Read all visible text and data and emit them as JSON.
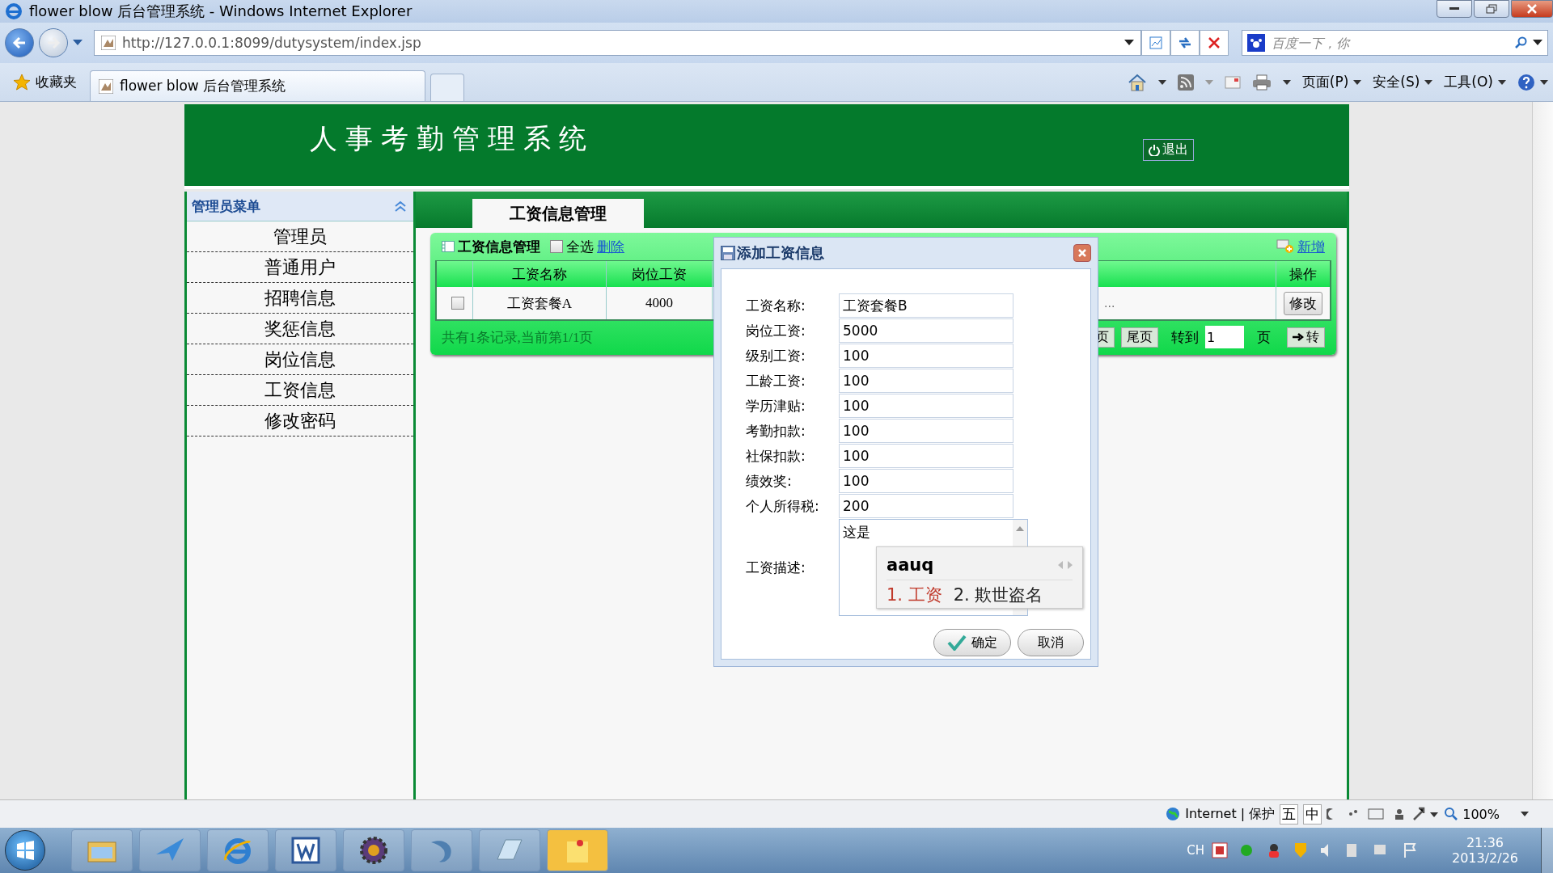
{
  "window": {
    "title": "flower blow 后台管理系统 - Windows Internet Explorer"
  },
  "address_bar": {
    "url": "http://127.0.0.1:8099/dutysystem/index.jsp"
  },
  "search": {
    "placeholder": "百度一下，你"
  },
  "favorites": {
    "label": "收藏夹"
  },
  "tabs": [
    {
      "label": "flower blow 后台管理系统",
      "selected": true
    }
  ],
  "command_bar": [
    {
      "label": "页面(P)"
    },
    {
      "label": "安全(S)"
    },
    {
      "label": "工具(O)"
    }
  ],
  "page": {
    "header_title": "人事考勤管理系统",
    "logout": "退出",
    "sidebar": {
      "title": "管理员菜单",
      "items": [
        {
          "label": "管理员"
        },
        {
          "label": "普通用户"
        },
        {
          "label": "招聘信息"
        },
        {
          "label": "奖惩信息"
        },
        {
          "label": "岗位信息"
        },
        {
          "label": "工资信息"
        },
        {
          "label": "修改密码"
        }
      ]
    },
    "main_tab": "工资信息管理",
    "grid": {
      "title": "工资信息管理",
      "select_all": {
        "label": "全选",
        "checked": false
      },
      "delete_link": "删除",
      "add_link": "新增",
      "columns": [
        "工资名称",
        "岗位工资",
        "操作"
      ],
      "rows": [
        {
          "checked": false,
          "name": "工资套餐A",
          "salary": "4000",
          "more": "...",
          "action": "修改"
        }
      ],
      "pager": {
        "summary": "共有1条记录,当前第1/1页",
        "buttons": [
          "页",
          "尾页"
        ],
        "goto_label": "转到",
        "page_value": "1",
        "page_unit": "页",
        "go_button": "转"
      }
    }
  },
  "dialog": {
    "title": "添加工资信息",
    "fields": [
      {
        "label": "工资名称:",
        "value": "工资套餐B"
      },
      {
        "label": "岗位工资:",
        "value": "5000"
      },
      {
        "label": "级别工资:",
        "value": "100"
      },
      {
        "label": "工龄工资:",
        "value": "100"
      },
      {
        "label": "学历津贴:",
        "value": "100"
      },
      {
        "label": "考勤扣款:",
        "value": "100"
      },
      {
        "label": "社保扣款:",
        "value": "100"
      },
      {
        "label": "绩效奖:",
        "value": "100"
      },
      {
        "label": "个人所得税:",
        "value": "200"
      }
    ],
    "description": {
      "label": "工资描述:",
      "value": "这是"
    },
    "buttons": [
      {
        "label": "确定",
        "kind": "confirm"
      },
      {
        "label": "取消",
        "kind": "cancel"
      }
    ]
  },
  "ime": {
    "input": "aauq",
    "candidates": [
      {
        "label": "1. 工资",
        "selected": true
      },
      {
        "label": "2. 欺世盗名",
        "selected": false
      }
    ]
  },
  "status_bar": {
    "zone": "Internet | 保护",
    "ime_bar": [
      "五",
      "中"
    ],
    "zoom": "100%"
  },
  "taskbar": {
    "language": "CH",
    "time": "21:36",
    "date": "2013/2/26"
  }
}
